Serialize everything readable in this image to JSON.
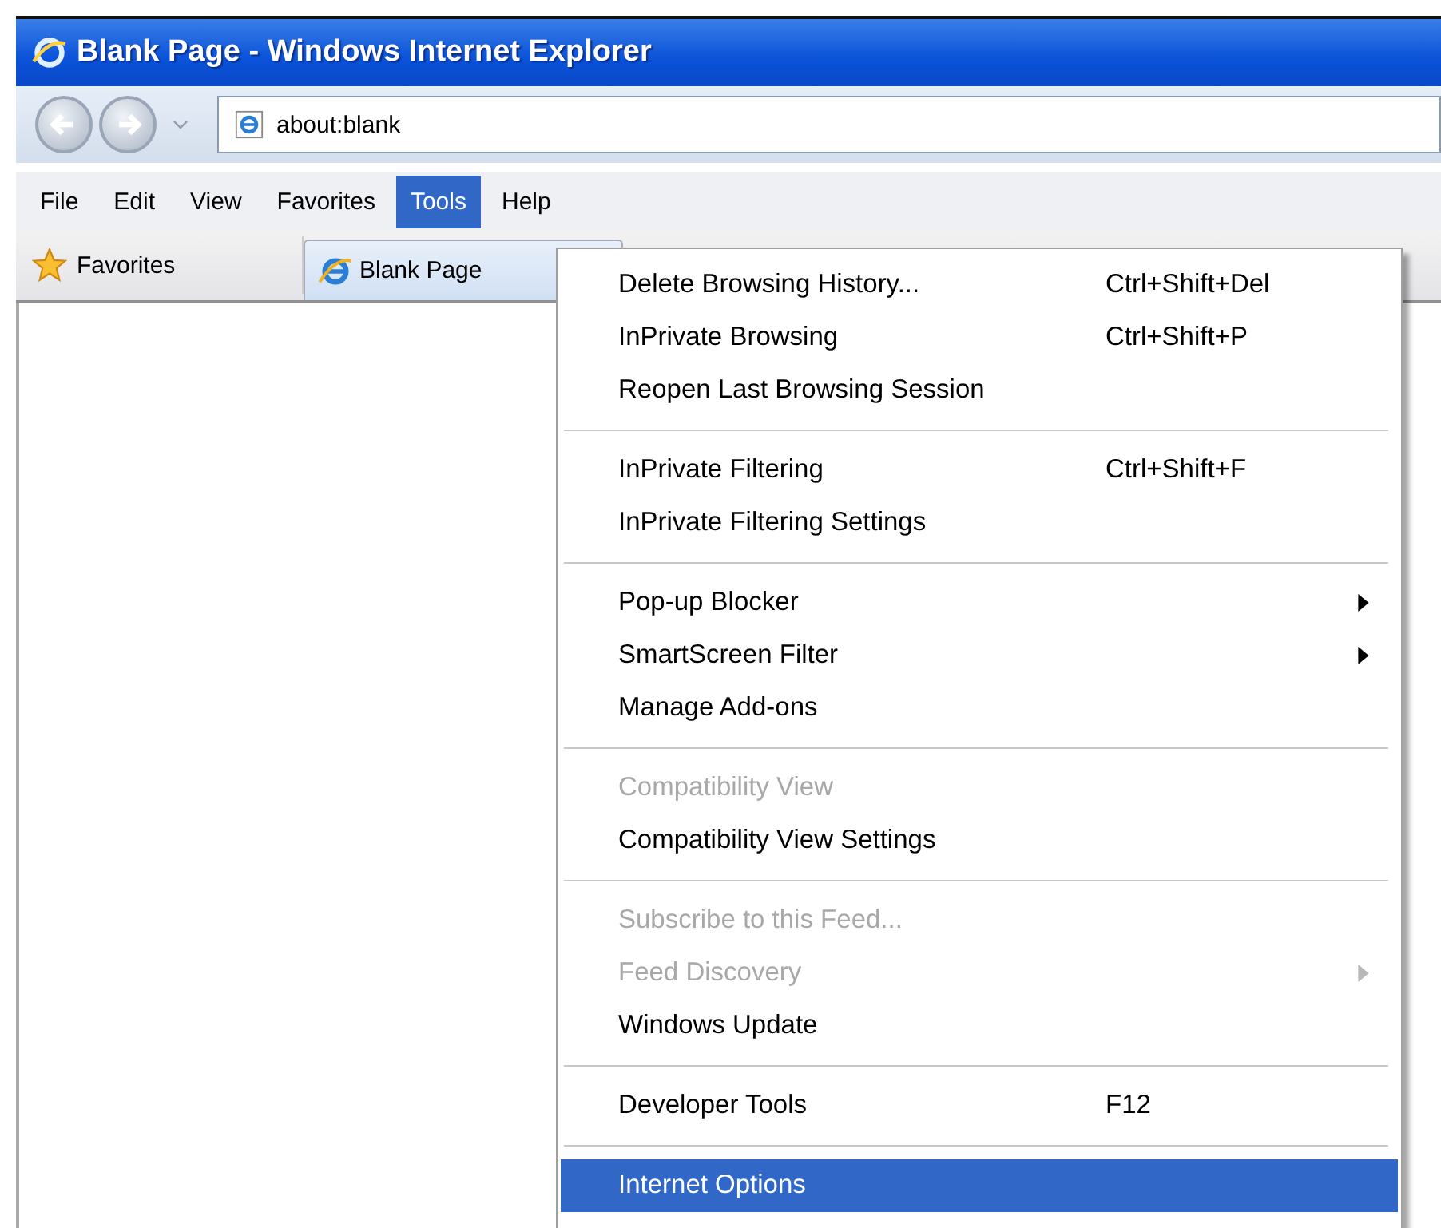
{
  "window": {
    "title": "Blank Page - Windows Internet Explorer"
  },
  "address_bar": {
    "value": "about:blank"
  },
  "menu_bar": [
    {
      "label": "File",
      "selected": false
    },
    {
      "label": "Edit",
      "selected": false
    },
    {
      "label": "View",
      "selected": false
    },
    {
      "label": "Favorites",
      "selected": false
    },
    {
      "label": "Tools",
      "selected": true
    },
    {
      "label": "Help",
      "selected": false
    }
  ],
  "favorites_bar": {
    "favorites_label": "Favorites",
    "tab_label": "Blank Page"
  },
  "tools_menu": [
    [
      {
        "label": "Delete Browsing History...",
        "shortcut": "Ctrl+Shift+Del",
        "disabled": false,
        "submenu": false,
        "selected": false
      },
      {
        "label": "InPrivate Browsing",
        "shortcut": "Ctrl+Shift+P",
        "disabled": false,
        "submenu": false,
        "selected": false
      },
      {
        "label": "Reopen Last Browsing Session",
        "disabled": false,
        "submenu": false,
        "selected": false
      }
    ],
    [
      {
        "label": "InPrivate Filtering",
        "shortcut": "Ctrl+Shift+F",
        "disabled": false,
        "submenu": false,
        "selected": false
      },
      {
        "label": "InPrivate Filtering Settings",
        "disabled": false,
        "submenu": false,
        "selected": false
      }
    ],
    [
      {
        "label": "Pop-up Blocker",
        "disabled": false,
        "submenu": true,
        "selected": false
      },
      {
        "label": "SmartScreen Filter",
        "disabled": false,
        "submenu": true,
        "selected": false
      },
      {
        "label": "Manage Add-ons",
        "disabled": false,
        "submenu": false,
        "selected": false
      }
    ],
    [
      {
        "label": "Compatibility View",
        "disabled": true,
        "submenu": false,
        "selected": false
      },
      {
        "label": "Compatibility View Settings",
        "disabled": false,
        "submenu": false,
        "selected": false
      }
    ],
    [
      {
        "label": "Subscribe to this Feed...",
        "disabled": true,
        "submenu": false,
        "selected": false
      },
      {
        "label": "Feed Discovery",
        "disabled": true,
        "submenu": true,
        "selected": false
      },
      {
        "label": "Windows Update",
        "disabled": false,
        "submenu": false,
        "selected": false
      }
    ],
    [
      {
        "label": "Developer Tools",
        "shortcut": "F12",
        "disabled": false,
        "submenu": false,
        "selected": false
      }
    ],
    [
      {
        "label": "Internet Options",
        "disabled": false,
        "submenu": false,
        "selected": true
      }
    ]
  ]
}
